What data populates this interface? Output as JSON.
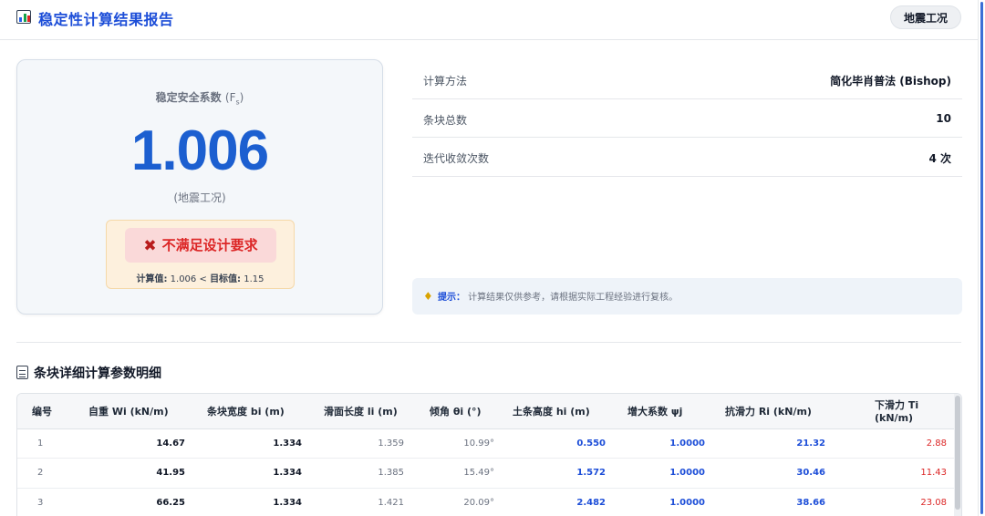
{
  "header": {
    "title": "稳定性计算结果报告",
    "mode_pill": "地震工况"
  },
  "result": {
    "fs_label": "稳定安全系数",
    "fs_symbol": "F",
    "fs_subscript": "s",
    "fs_value": "1.006",
    "condition": "(地震工况)",
    "verdict": "不满足设计要求",
    "calc_label": "计算值:",
    "calc_value": "1.006",
    "cmp": "<",
    "target_label": "目标值:",
    "target_value": "1.15"
  },
  "info": [
    {
      "k": "计算方法",
      "v": "简化毕肖普法 (Bishop)"
    },
    {
      "k": "条块总数",
      "v": "10"
    },
    {
      "k": "迭代收敛次数",
      "v": "4 次"
    }
  ],
  "tip": {
    "label": "提示：",
    "text": "计算结果仅供参考，请根据实际工程经验进行复核。"
  },
  "table": {
    "title": "条块详细计算参数明细",
    "headers": [
      "编号",
      "自重 Wi (kN/m)",
      "条块宽度 bi (m)",
      "滑面长度 li (m)",
      "倾角 θi (°)",
      "土条高度 hi (m)",
      "增大系数 ψj",
      "抗滑力 Ri (kN/m)",
      "下滑力 Ti (kN/m)"
    ],
    "rows": [
      [
        "1",
        "14.67",
        "1.334",
        "1.359",
        "10.99°",
        "0.550",
        "1.0000",
        "21.32",
        "2.88"
      ],
      [
        "2",
        "41.95",
        "1.334",
        "1.385",
        "15.49°",
        "1.572",
        "1.0000",
        "30.46",
        "11.43"
      ],
      [
        "3",
        "66.25",
        "1.334",
        "1.421",
        "20.09°",
        "2.482",
        "1.0000",
        "38.66",
        "23.08"
      ]
    ]
  },
  "colors": {
    "accent": "#1c5fd0",
    "danger": "#dc2626",
    "warn_bg": "#fdf0dd"
  },
  "icons": [
    "bar-chart-icon",
    "clipboard-icon",
    "cross-mark-icon",
    "lightbulb-icon"
  ]
}
